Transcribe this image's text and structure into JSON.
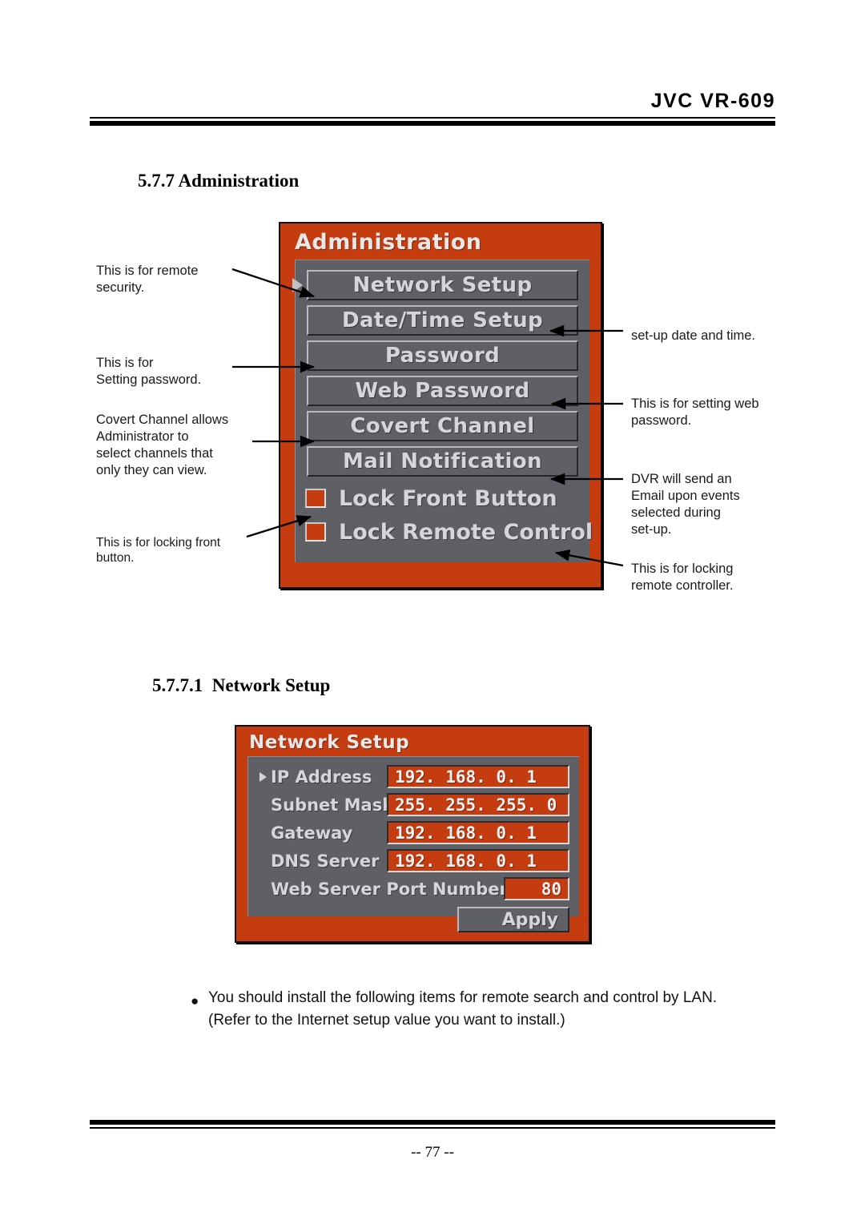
{
  "header": {
    "title": "JVC VR-609"
  },
  "sections": {
    "admin_heading": "5.7.7 Administration",
    "network_heading": "5.7.7.1  Network Setup"
  },
  "admin_panel": {
    "title": "Administration",
    "menu_items": [
      {
        "label": "Network Setup",
        "selected": true
      },
      {
        "label": "Date/Time Setup",
        "selected": false
      },
      {
        "label": "Password",
        "selected": false
      },
      {
        "label": "Web Password",
        "selected": false
      },
      {
        "label": "Covert Channel",
        "selected": false
      },
      {
        "label": "Mail Notification",
        "selected": false
      }
    ],
    "checkboxes": [
      {
        "label": "Lock Front Button",
        "checked": true
      },
      {
        "label": "Lock Remote Control",
        "checked": true
      }
    ]
  },
  "admin_annotations": {
    "left": [
      {
        "text": "This is for remote\nsecurity."
      },
      {
        "text": "This is for\nSetting password."
      },
      {
        "text": "Covert Channel allows\nAdministrator to\nselect channels that\nonly they can view."
      },
      {
        "text": "This is for locking front\nbutton."
      }
    ],
    "right": [
      {
        "text": "set-up date and time."
      },
      {
        "text": "This is for setting web\npassword."
      },
      {
        "text": "DVR will send an\nEmail upon events\nselected during\nset-up."
      },
      {
        "text": "This  is  for  locking\nremote controller."
      }
    ]
  },
  "network_panel": {
    "title": "Network Setup",
    "fields": [
      {
        "label": "IP Address",
        "value": "192. 168. 0. 1",
        "selected": true,
        "box": "wide"
      },
      {
        "label": "Subnet Mask",
        "value": "255. 255. 255. 0",
        "selected": false,
        "box": "wide"
      },
      {
        "label": "Gateway",
        "value": "192. 168. 0. 1",
        "selected": false,
        "box": "wide"
      },
      {
        "label": "DNS Server",
        "value": "192. 168. 0. 1",
        "selected": false,
        "box": "wide"
      },
      {
        "label": "Web Server Port Number",
        "value": "80",
        "selected": false,
        "box": "narrow"
      }
    ],
    "apply_label": "Apply"
  },
  "bottom_note": {
    "bullet": "●",
    "text": "You should install the following items for remote search and control by LAN.\n(Refer to the Internet setup value you want to install.)"
  },
  "footer": {
    "page_number": "-- 77 --"
  },
  "colors": {
    "osd_orange": "#c43c10",
    "osd_gray": "#5f5f66",
    "osd_text": "#d5d5da"
  }
}
